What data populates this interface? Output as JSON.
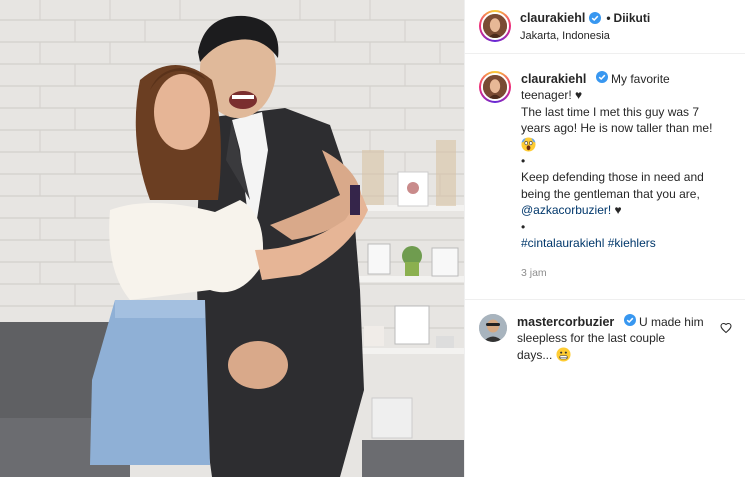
{
  "post": {
    "username": "claurakiehl",
    "follow_status": "Diikuti",
    "location": "Jakarta, Indonesia",
    "caption": {
      "line1": "My favorite teenager! ♥",
      "line2": "The last time I met this guy was 7",
      "line3": "years ago! He is now taller than me!",
      "sep1": "•",
      "line4": "Keep defending those in need and",
      "line5": "being the gentleman that you are,",
      "mention": "@azkacorbuzier!",
      "mention_tail": " ♥",
      "sep2": "•",
      "hashtag1": "#cintalaurakiehl",
      "hashtag2": "#kiehlers"
    },
    "time": "3 jam"
  },
  "comment": {
    "username": "mastercorbuzier",
    "text_line1": "U made him",
    "text_line2": "sleepless for the last couple",
    "text_line3": "days..."
  },
  "colors": {
    "verified": "#3897f0",
    "link": "#00376b",
    "muted": "#8e8e8e",
    "border": "#efefef"
  },
  "icons": {
    "verified": "verified-badge-icon",
    "emoji_scream": "face-screaming-emoji",
    "emoji_grin": "grimacing-face-emoji",
    "heart": "heart-outline-icon"
  }
}
